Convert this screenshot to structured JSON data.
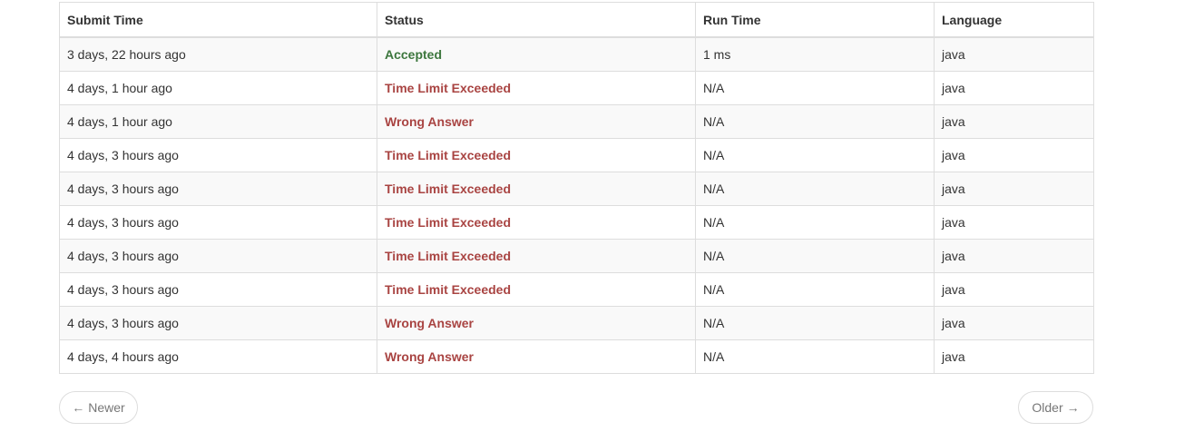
{
  "table": {
    "headers": {
      "submit_time": "Submit Time",
      "status": "Status",
      "run_time": "Run Time",
      "language": "Language"
    },
    "rows": [
      {
        "submit_time": "3 days, 22 hours ago",
        "status": "Accepted",
        "run_time": "1 ms",
        "language": "java"
      },
      {
        "submit_time": "4 days, 1 hour ago",
        "status": "Time Limit Exceeded",
        "run_time": "N/A",
        "language": "java"
      },
      {
        "submit_time": "4 days, 1 hour ago",
        "status": "Wrong Answer",
        "run_time": "N/A",
        "language": "java"
      },
      {
        "submit_time": "4 days, 3 hours ago",
        "status": "Time Limit Exceeded",
        "run_time": "N/A",
        "language": "java"
      },
      {
        "submit_time": "4 days, 3 hours ago",
        "status": "Time Limit Exceeded",
        "run_time": "N/A",
        "language": "java"
      },
      {
        "submit_time": "4 days, 3 hours ago",
        "status": "Time Limit Exceeded",
        "run_time": "N/A",
        "language": "java"
      },
      {
        "submit_time": "4 days, 3 hours ago",
        "status": "Time Limit Exceeded",
        "run_time": "N/A",
        "language": "java"
      },
      {
        "submit_time": "4 days, 3 hours ago",
        "status": "Time Limit Exceeded",
        "run_time": "N/A",
        "language": "java"
      },
      {
        "submit_time": "4 days, 3 hours ago",
        "status": "Wrong Answer",
        "run_time": "N/A",
        "language": "java"
      },
      {
        "submit_time": "4 days, 4 hours ago",
        "status": "Wrong Answer",
        "run_time": "N/A",
        "language": "java"
      }
    ]
  },
  "pager": {
    "newer_arrow": "←",
    "newer_label": "Newer",
    "older_label": "Older",
    "older_arrow": "→"
  },
  "colors": {
    "accepted": "#3c763d",
    "error": "#a94442",
    "border": "#dddddd",
    "stripe": "#f9f9f9"
  }
}
